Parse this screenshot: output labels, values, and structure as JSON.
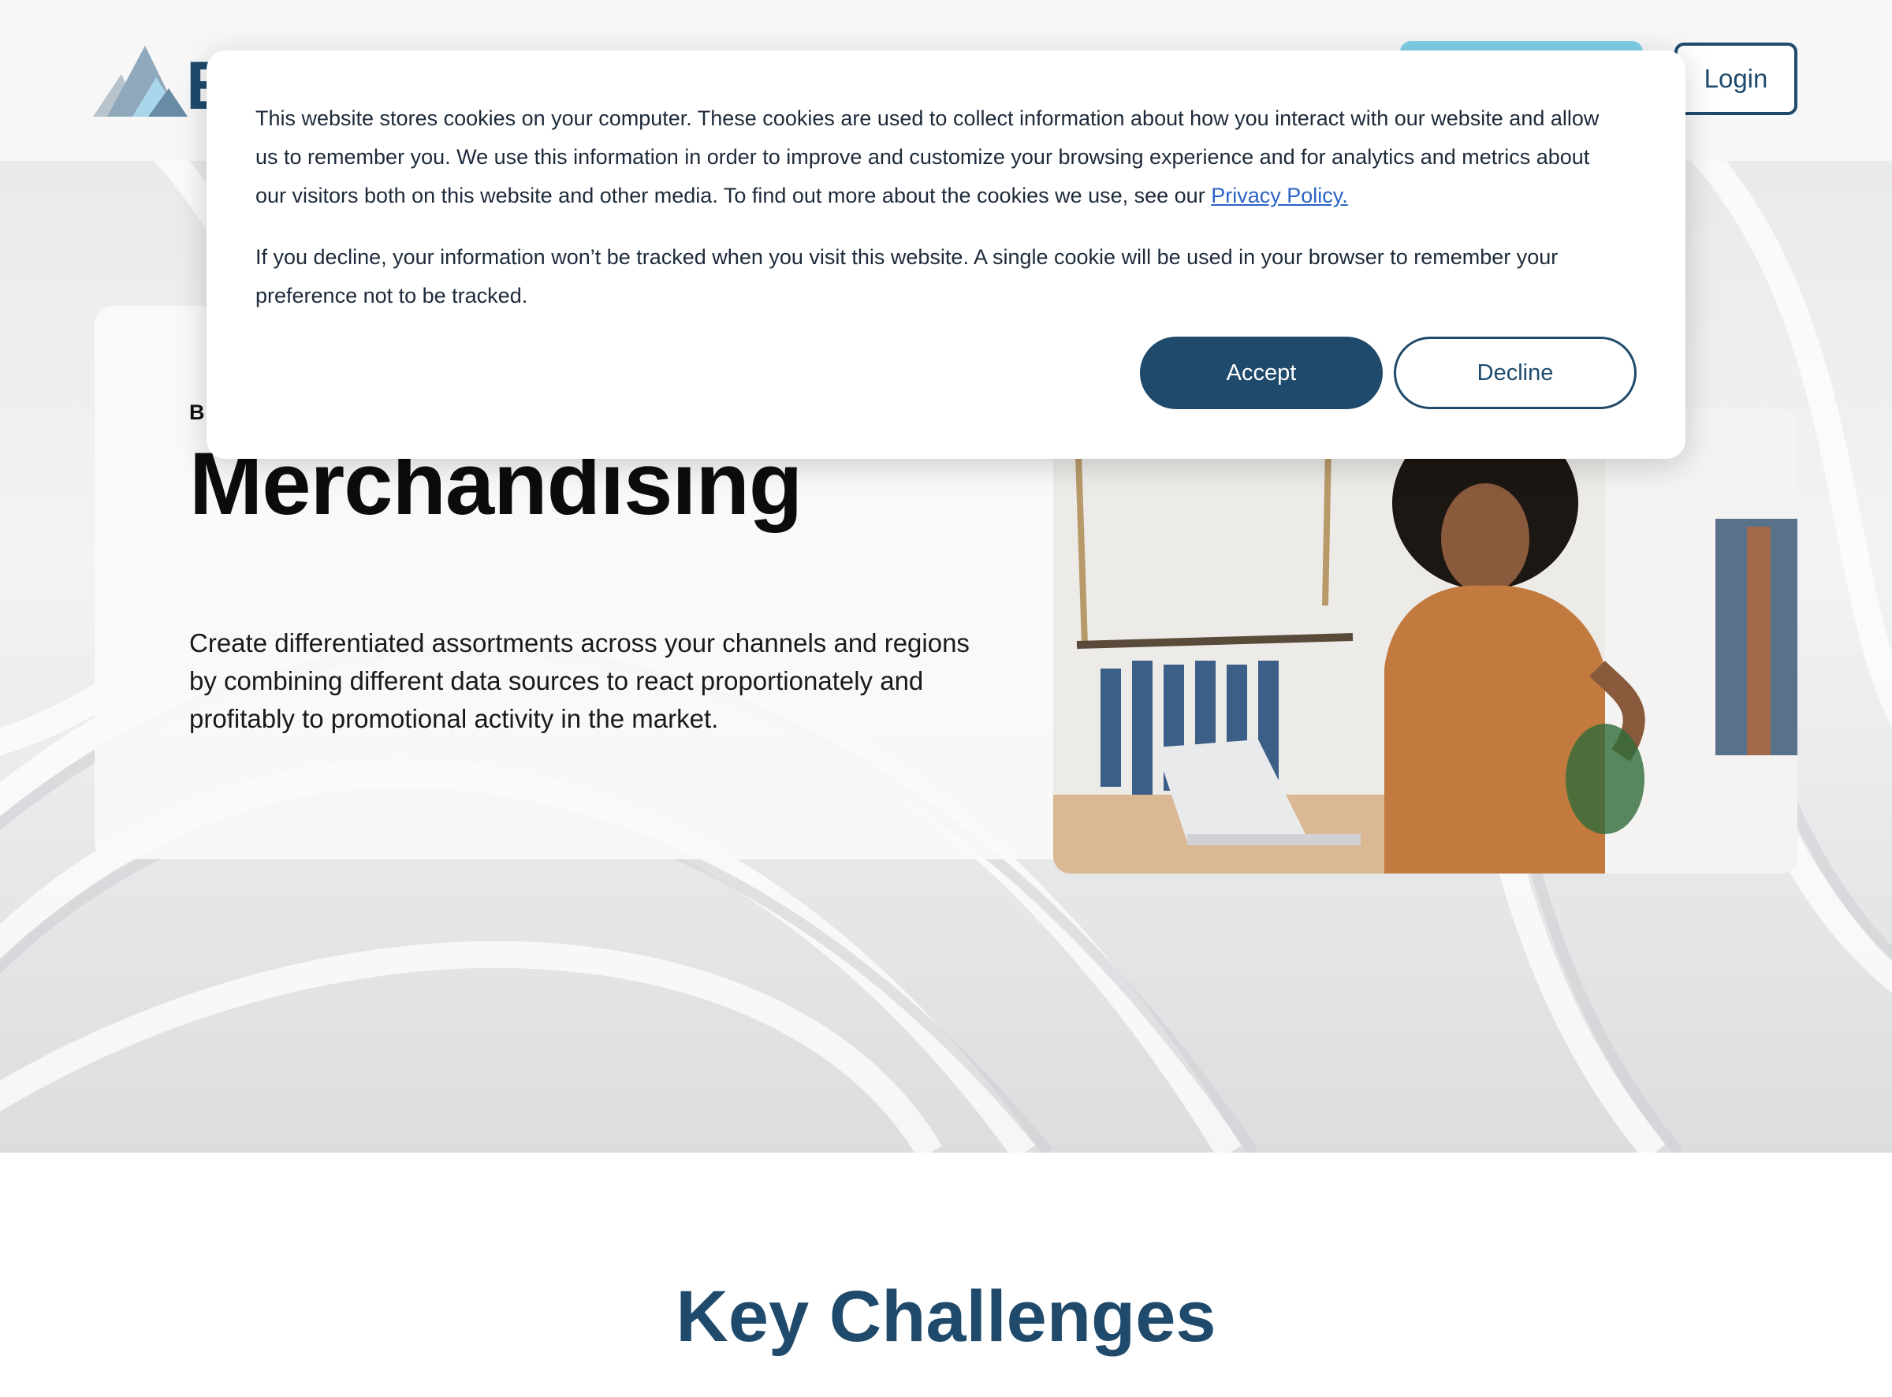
{
  "header": {
    "logo_letter": "E",
    "login_label": "Login"
  },
  "hero": {
    "eyebrow": "B",
    "title": "Merchandising",
    "description": "Create differentiated assortments across your channels and regions by combining different data sources to react proportionately and profitably to promotional activity in the market."
  },
  "section": {
    "title": "Key Challenges"
  },
  "cookie_banner": {
    "text_1": "This website stores cookies on your computer. These cookies are used to collect information about how you interact with our website and allow us to remember you. We use this information in order to improve and customize your browsing experience and for analytics and metrics about our visitors both on this website and other media. To find out more about the cookies we use, see our ",
    "privacy_link": "Privacy Policy.",
    "text_2": "If you decline, your information won’t be tracked when you visit this website. A single cookie will be used in your browser to remember your preference not to be tracked.",
    "accept_label": "Accept",
    "decline_label": "Decline"
  },
  "colors": {
    "brand": "#1f4a6b",
    "accent": "#7fd0e8",
    "link": "#2a63c7"
  }
}
